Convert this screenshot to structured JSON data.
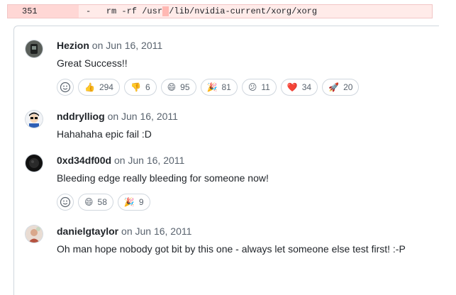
{
  "diff": {
    "line_number": "351",
    "code_prefix": "-   rm -rf /usr",
    "code_highlight": " ",
    "code_suffix": "/lib/nvidia-current/xorg/xorg"
  },
  "comments": [
    {
      "author": "Hezion",
      "date": "on Jun 16, 2011",
      "body": "Great Success!!",
      "reactions": [
        {
          "emoji": "👍",
          "icon": "thumbs-up-icon",
          "count": "294"
        },
        {
          "emoji": "👎",
          "icon": "thumbs-down-icon",
          "count": "6"
        },
        {
          "emoji": "😄",
          "icon": "laugh-icon",
          "count": "95"
        },
        {
          "emoji": "🎉",
          "icon": "hooray-icon",
          "count": "81"
        },
        {
          "emoji": "😕",
          "icon": "confused-icon",
          "count": "11"
        },
        {
          "emoji": "❤️",
          "icon": "heart-icon",
          "count": "34"
        },
        {
          "emoji": "🚀",
          "icon": "rocket-icon",
          "count": "20"
        }
      ]
    },
    {
      "author": "nddrylliog",
      "date": "on Jun 16, 2011",
      "body": "Hahahaha epic fail :D",
      "reactions": []
    },
    {
      "author": "0xd34df00d",
      "date": "on Jun 16, 2011",
      "body": "Bleeding edge really bleeding for someone now!",
      "reactions": [
        {
          "emoji": "😄",
          "icon": "laugh-icon",
          "count": "58"
        },
        {
          "emoji": "🎉",
          "icon": "hooray-icon",
          "count": "9"
        }
      ]
    },
    {
      "author": "danielgtaylor",
      "date": "on Jun 16, 2011",
      "body": "Oh man hope nobody got bit by this one - always let someone else test first! :-P",
      "reactions": []
    }
  ]
}
